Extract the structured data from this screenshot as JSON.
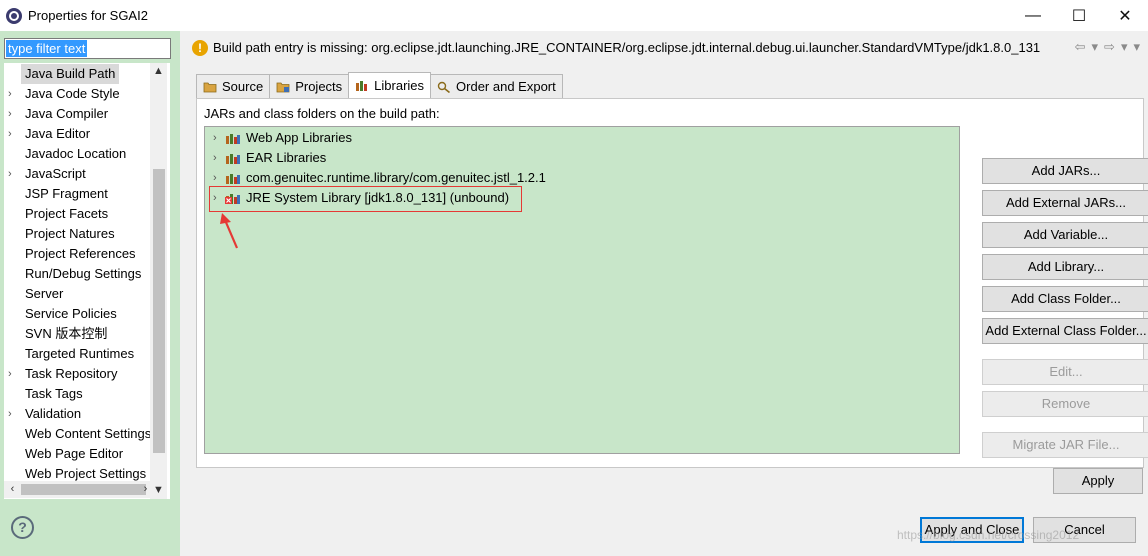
{
  "window": {
    "title": "Properties for SGAI2",
    "minimize": "—",
    "maximize": "☐",
    "close": "✕"
  },
  "sidebar": {
    "filter_text": "type filter text",
    "items": [
      {
        "label": "Java Build Path",
        "expandable": false,
        "selected": true
      },
      {
        "label": "Java Code Style",
        "expandable": true
      },
      {
        "label": "Java Compiler",
        "expandable": true
      },
      {
        "label": "Java Editor",
        "expandable": true
      },
      {
        "label": "Javadoc Location",
        "expandable": false
      },
      {
        "label": "JavaScript",
        "expandable": true
      },
      {
        "label": "JSP Fragment",
        "expandable": false
      },
      {
        "label": "Project Facets",
        "expandable": false
      },
      {
        "label": "Project Natures",
        "expandable": false
      },
      {
        "label": "Project References",
        "expandable": false
      },
      {
        "label": "Run/Debug Settings",
        "expandable": false
      },
      {
        "label": "Server",
        "expandable": false
      },
      {
        "label": "Service Policies",
        "expandable": false
      },
      {
        "label": "SVN 版本控制",
        "expandable": false
      },
      {
        "label": "Targeted Runtimes",
        "expandable": false
      },
      {
        "label": "Task Repository",
        "expandable": true
      },
      {
        "label": "Task Tags",
        "expandable": false
      },
      {
        "label": "Validation",
        "expandable": true
      },
      {
        "label": "Web Content Settings",
        "expandable": false
      },
      {
        "label": "Web Page Editor",
        "expandable": false
      },
      {
        "label": "Web Project Settings",
        "expandable": false
      }
    ]
  },
  "message": {
    "text": "Build path entry is missing: org.eclipse.jdt.launching.JRE_CONTAINER/org.eclipse.jdt.internal.debug.ui.launcher.StandardVMType/jdk1.8.0_131",
    "icon": "warning-icon"
  },
  "tabs": [
    {
      "label": "Source",
      "active": false
    },
    {
      "label": "Projects",
      "active": false
    },
    {
      "label": "Libraries",
      "active": true
    },
    {
      "label": "Order and Export",
      "active": false
    }
  ],
  "libraries": {
    "header": "JARs and class folders on the build path:",
    "items": [
      {
        "label": "Web App Libraries",
        "error": false
      },
      {
        "label": "EAR Libraries",
        "error": false
      },
      {
        "label": "com.genuitec.runtime.library/com.genuitec.jstl_1.2.1",
        "error": false
      },
      {
        "label": "JRE System Library [jdk1.8.0_131] (unbound)",
        "error": true
      }
    ]
  },
  "buttons": {
    "add_jars": "Add JARs...",
    "add_external_jars": "Add External JARs...",
    "add_variable": "Add Variable...",
    "add_library": "Add Library...",
    "add_class_folder": "Add Class Folder...",
    "add_external_class_folder": "Add External Class Folder...",
    "edit": "Edit...",
    "remove": "Remove",
    "migrate_jar": "Migrate JAR File...",
    "apply": "Apply",
    "apply_and_close": "Apply and Close",
    "cancel": "Cancel",
    "help": "?"
  },
  "watermark": "https://blog.csdn.net/crossing2012",
  "colors": {
    "panel_bg": "#c8e6c9",
    "highlight": "#e53935",
    "selection": "#3399ff"
  }
}
